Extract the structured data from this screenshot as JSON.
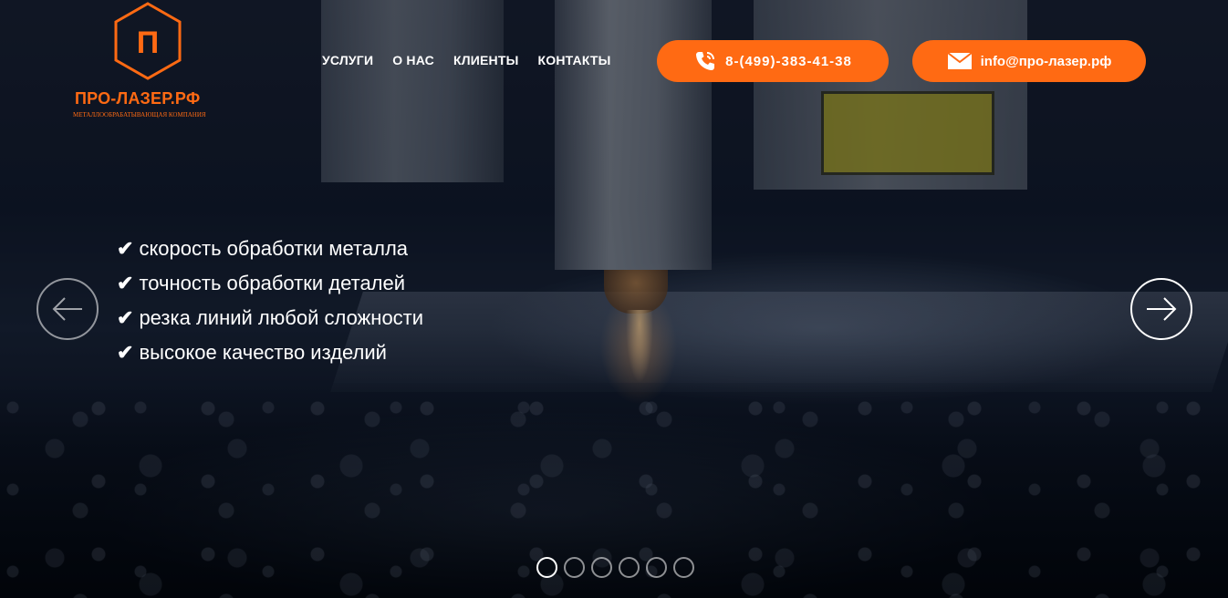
{
  "logo": {
    "letter": "П",
    "name": "ПРО-ЛАЗЕР.РФ",
    "tagline": "МЕТАЛЛООБРАБАТЫВАЮЩАЯ КОМПАНИЯ",
    "color": "#ff6a13"
  },
  "nav": {
    "items": [
      {
        "label": "УСЛУГИ"
      },
      {
        "label": "О НАС"
      },
      {
        "label": "КЛИЕНТЫ"
      },
      {
        "label": "КОНТАКТЫ"
      }
    ]
  },
  "contacts": {
    "phone": {
      "label": "8-(499)-383-41-38",
      "icon": "phone-icon"
    },
    "email": {
      "label": "info@про-лазер.рф",
      "icon": "envelope-icon"
    }
  },
  "slider": {
    "features": [
      {
        "check": "✔",
        "text": "скорость обработки металла"
      },
      {
        "check": "✔",
        "text": "точность обработки деталей"
      },
      {
        "check": "✔",
        "text": "резка линий любой сложности"
      },
      {
        "check": "✔",
        "text": "высокое качество изделий"
      }
    ],
    "prev_icon": "arrow-left-icon",
    "next_icon": "arrow-right-icon",
    "dots_total": 6,
    "active_dot": 1
  },
  "colors": {
    "accent": "#ff6a13",
    "text": "#ffffff"
  }
}
